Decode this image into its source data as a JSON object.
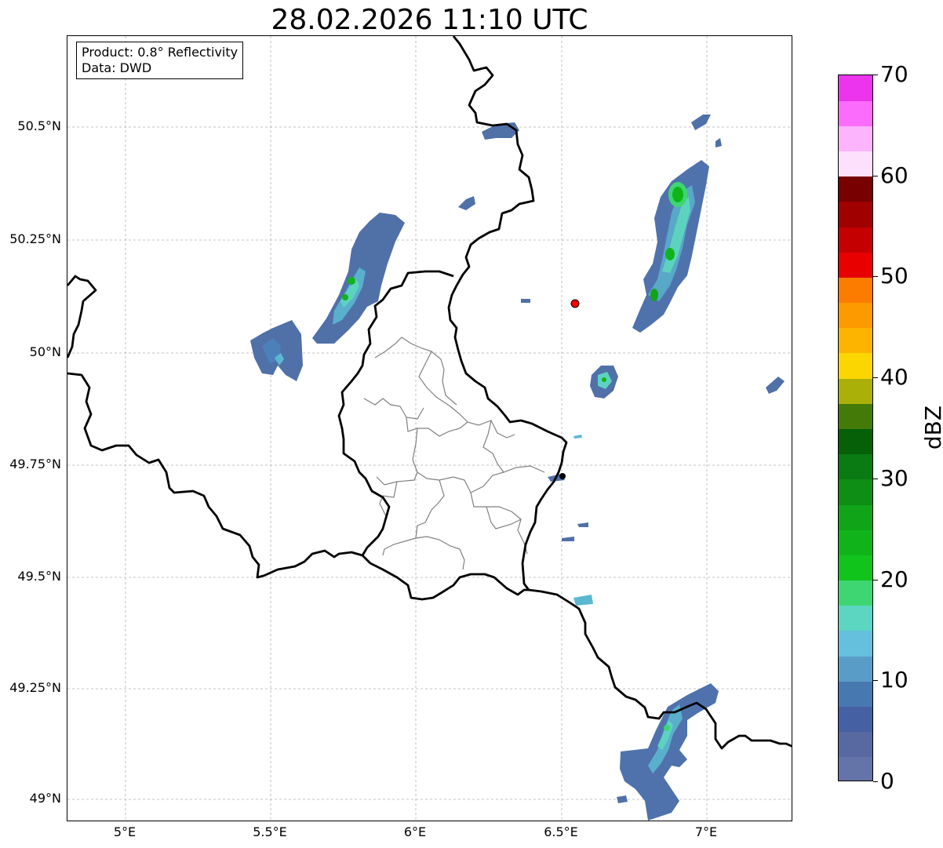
{
  "title": "28.02.2026 11:10 UTC",
  "info": {
    "product": "Product: 0.8° Reflectivity",
    "source": "Data: DWD"
  },
  "axes": {
    "lat_ticks": [
      "50.5°N",
      "50.25°N",
      "50°N",
      "49.75°N",
      "49.5°N",
      "49.25°N",
      "49°N"
    ],
    "lon_ticks": [
      "5°E",
      "5.5°E",
      "6°E",
      "6.5°E",
      "7°E"
    ]
  },
  "colorbar": {
    "label": "dBZ",
    "ticks": [
      "0",
      "10",
      "20",
      "30",
      "40",
      "50",
      "60",
      "70"
    ],
    "min": 0,
    "max": 70,
    "step": 2.5,
    "colors": [
      "#6474a8",
      "#5868a0",
      "#4660a4",
      "#4878b0",
      "#5a9cc8",
      "#64c0dc",
      "#5cd6c0",
      "#3ed672",
      "#10c41c",
      "#10b41a",
      "#10a418",
      "#0e8e14",
      "#0a7a12",
      "#056008",
      "#447a08",
      "#aab008",
      "#fcd600",
      "#fcb400",
      "#fc9a00",
      "#fc7c00",
      "#e80000",
      "#c40000",
      "#a00000",
      "#780000",
      "#fce0fc",
      "#fcb4fc",
      "#fc6cfc",
      "#ec34ec"
    ]
  },
  "colors": {
    "border_national": "#000000",
    "border_regional": "#808080",
    "radar_site": "#ff0000"
  }
}
